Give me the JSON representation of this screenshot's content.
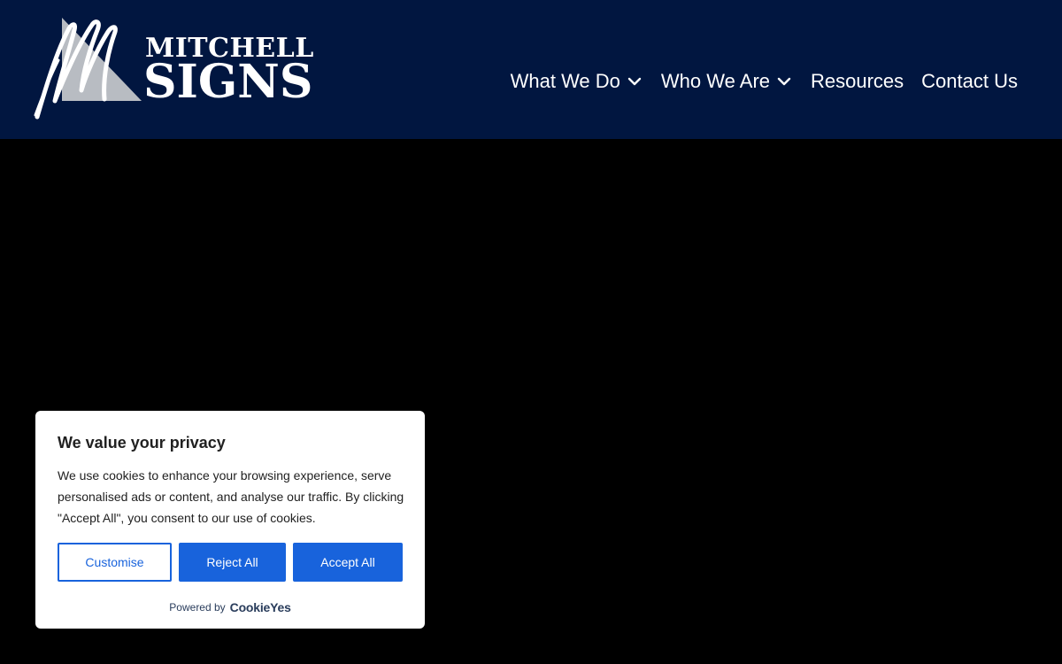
{
  "header": {
    "background": "#011640",
    "logo": {
      "line1": "MITCHELL",
      "line2": "SIGNS",
      "alt_icon": "mitchell-signs-logo-icon"
    },
    "nav": [
      {
        "label": "What We Do",
        "has_dropdown": true
      },
      {
        "label": "Who We Are",
        "has_dropdown": true
      },
      {
        "label": "Resources",
        "has_dropdown": false
      },
      {
        "label": "Contact Us",
        "has_dropdown": false
      }
    ]
  },
  "main": {
    "background": "#000000"
  },
  "cookie_banner": {
    "title": "We value your privacy",
    "description": "We use cookies to enhance your browsing experience, serve personalised ads or content, and analyse our traffic. By clicking \"Accept All\", you consent to our use of cookies.",
    "buttons": {
      "customise": "Customise",
      "reject": "Reject All",
      "accept": "Accept All"
    },
    "powered_by": "Powered by",
    "brand": "CookieYes",
    "accent": "#1863dc"
  }
}
